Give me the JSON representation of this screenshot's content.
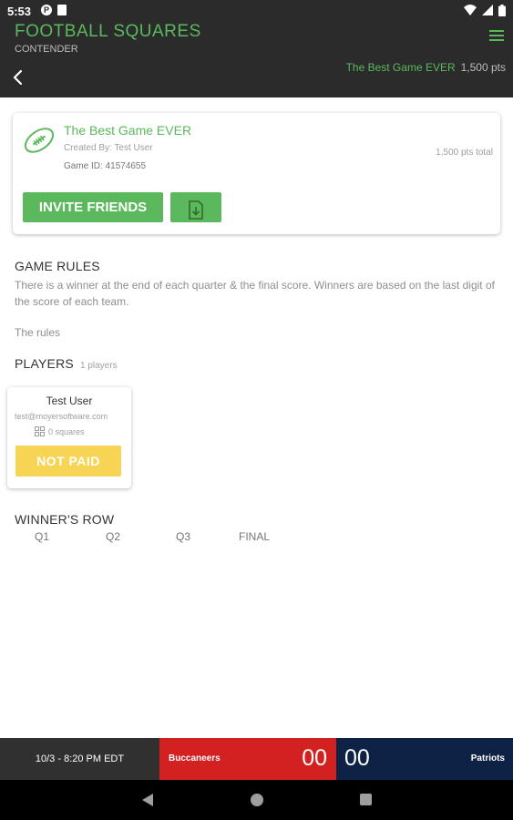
{
  "status_bar": {
    "time": "5:53"
  },
  "header": {
    "title": "FOOTBALL SQUARES",
    "subtitle": "CONTENDER",
    "game_name": "The Best Game EVER",
    "game_points": "1,500 pts",
    "icons": {
      "menu": "hamburger-menu-icon",
      "back": "back-arrow-icon"
    }
  },
  "game_card": {
    "name": "The Best Game EVER",
    "created_by": "Created By: Test User",
    "game_id": "Game ID: 41574655",
    "total": "1,500 pts total",
    "invite_label": "INVITE FRIENDS",
    "icons": {
      "football": "football-icon",
      "download": "download-file-icon"
    }
  },
  "rules": {
    "title": "GAME RULES",
    "text": "There is a winner at the end of each quarter & the final score. Winners are based on the last digit of the score of each team.",
    "extra": "The rules"
  },
  "players": {
    "title": "PLAYERS",
    "count": "1 players",
    "list": [
      {
        "name": "Test User",
        "email": "test@moyersoftware.com",
        "squares": "0 squares",
        "status_label": "NOT PAID"
      }
    ]
  },
  "winners_row": {
    "title": "WINNER'S ROW",
    "quarters": [
      "Q1",
      "Q2",
      "Q3",
      "FINAL"
    ]
  },
  "score_bar": {
    "datetime": "10/3 - 8:20 PM EDT",
    "home_team": "Buccaneers",
    "home_score": "00",
    "away_team": "Patriots",
    "away_score": "00",
    "colors": {
      "home": "#d32020",
      "away": "#0e2246"
    }
  },
  "colors": {
    "accent": "#5cb85c",
    "not_paid": "#f7d453"
  }
}
